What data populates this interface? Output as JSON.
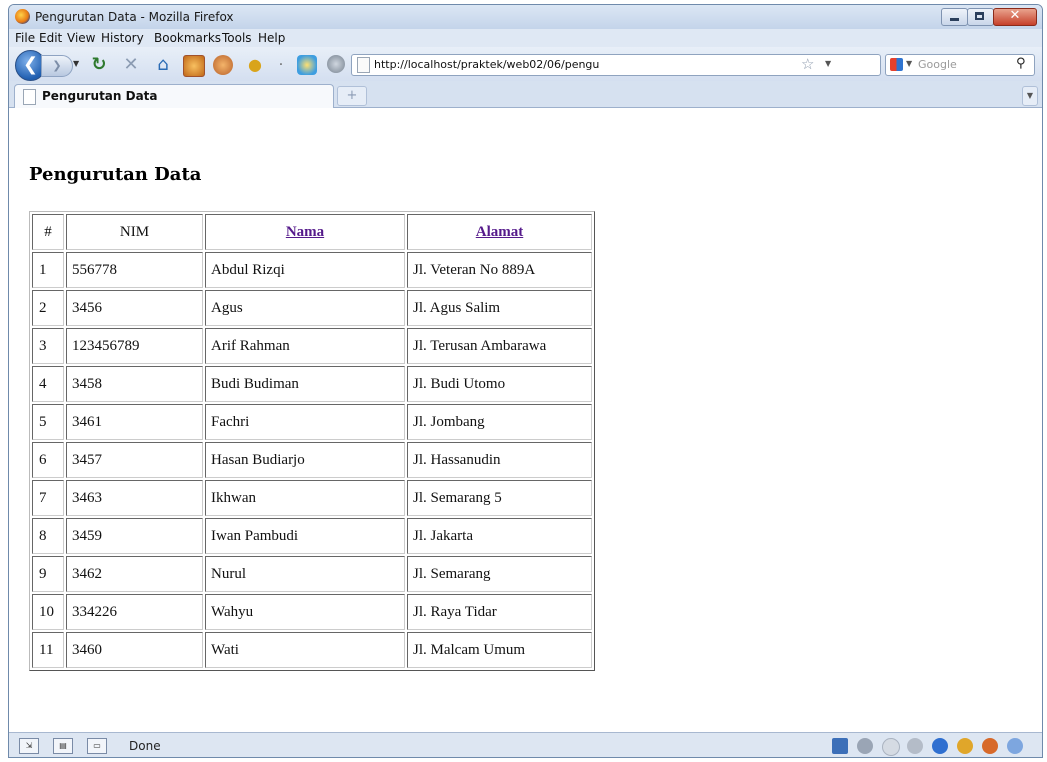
{
  "window": {
    "title": "Pengurutan Data - Mozilla Firefox"
  },
  "menu": [
    "File",
    "Edit",
    "View",
    "History",
    "Bookmarks",
    "Tools",
    "Help"
  ],
  "navbar": {
    "url": "http://localhost/praktek/web02/06/pengu",
    "search_placeholder": "Google"
  },
  "tab": {
    "label": "Pengurutan Data"
  },
  "page": {
    "heading": "Pengurutan Data",
    "columns": [
      "#",
      "NIM",
      "Nama",
      "Alamat"
    ],
    "rows": [
      {
        "no": "1",
        "nim": "556778",
        "nama": "Abdul Rizqi",
        "alamat": "Jl. Veteran No 889A"
      },
      {
        "no": "2",
        "nim": "3456",
        "nama": "Agus",
        "alamat": "Jl. Agus Salim"
      },
      {
        "no": "3",
        "nim": "123456789",
        "nama": "Arif Rahman",
        "alamat": "Jl. Terusan Ambarawa"
      },
      {
        "no": "4",
        "nim": "3458",
        "nama": "Budi Budiman",
        "alamat": "Jl. Budi Utomo"
      },
      {
        "no": "5",
        "nim": "3461",
        "nama": "Fachri",
        "alamat": "Jl. Jombang"
      },
      {
        "no": "6",
        "nim": "3457",
        "nama": "Hasan Budiarjo",
        "alamat": "Jl. Hassanudin"
      },
      {
        "no": "7",
        "nim": "3463",
        "nama": "Ikhwan",
        "alamat": "Jl. Semarang 5"
      },
      {
        "no": "8",
        "nim": "3459",
        "nama": "Iwan Pambudi",
        "alamat": "Jl. Jakarta"
      },
      {
        "no": "9",
        "nim": "3462",
        "nama": "Nurul",
        "alamat": "Jl. Semarang"
      },
      {
        "no": "10",
        "nim": "334226",
        "nama": "Wahyu",
        "alamat": "Jl. Raya Tidar"
      },
      {
        "no": "11",
        "nim": "3460",
        "nama": "Wati",
        "alamat": "Jl. Malcam Umum"
      }
    ]
  },
  "status": {
    "text": "Done"
  },
  "colors": {
    "link_visited": "#551a8b",
    "chrome_bg": "#d6e1f0"
  }
}
